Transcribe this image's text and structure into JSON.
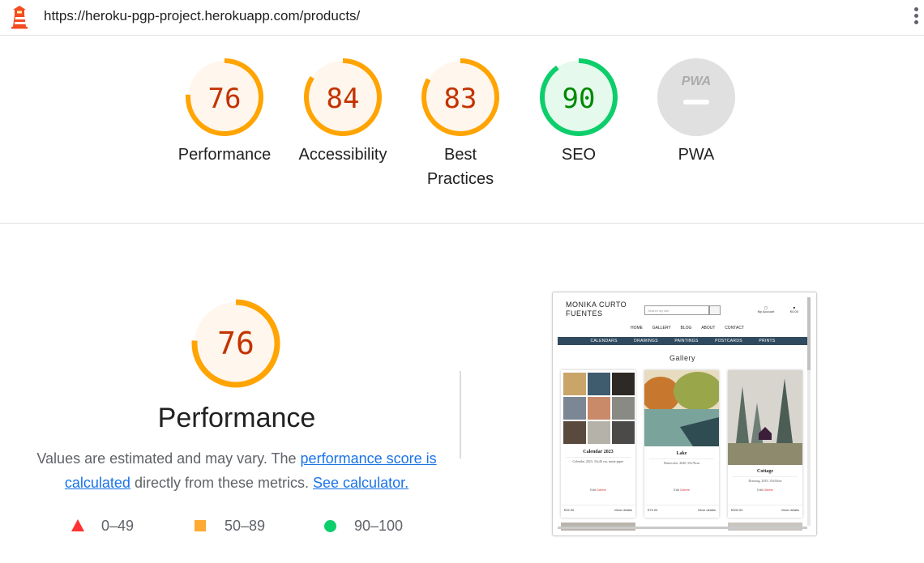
{
  "topbar": {
    "url": "https://heroku-pgp-project.herokuapp.com/products/",
    "logo_icon": "lighthouse-icon",
    "menu_icon": "kebab-menu-icon"
  },
  "gauges": [
    {
      "label": "Performance",
      "score": "76",
      "fraction": 0.76,
      "color": "#ffa400",
      "text_color": "#c33300",
      "bg": "#fff6ed"
    },
    {
      "label": "Accessibility",
      "score": "84",
      "fraction": 0.84,
      "color": "#ffa400",
      "text_color": "#c33300",
      "bg": "#fff6ed"
    },
    {
      "label": "Best Practices",
      "score": "83",
      "fraction": 0.83,
      "color": "#ffa400",
      "text_color": "#c33300",
      "bg": "#fff6ed"
    },
    {
      "label": "SEO",
      "score": "90",
      "fraction": 0.9,
      "color": "#0cce6b",
      "text_color": "#008800",
      "bg": "#e5f9ed"
    },
    {
      "label": "PWA",
      "badge": "PWA",
      "color": "#e0e0e0"
    }
  ],
  "performance": {
    "score": "76",
    "fraction": 0.76,
    "title": "Performance",
    "desc_prefix": "Values are estimated and may vary. The ",
    "score_link": "performance score is calculated",
    "desc_middle": " directly from these metrics. ",
    "calc_link": "See calculator.",
    "legend": [
      {
        "icon": "red-triangle-icon",
        "range": "0–49",
        "color": "#ff3333"
      },
      {
        "icon": "orange-square-icon",
        "range": "50–89",
        "color": "#ffaa33"
      },
      {
        "icon": "green-circle-icon",
        "range": "90–100",
        "color": "#0cce6b"
      }
    ]
  },
  "thumbnail": {
    "brand": "MONIKA CURTO FUENTES",
    "search_placeholder": "Search my site",
    "account": "My Account",
    "bag_total": "€0.00",
    "nav": [
      "HOME",
      "GALLERY",
      "BLOG",
      "ABOUT",
      "CONTACT"
    ],
    "categories": [
      "CALENDARS",
      "DRAWINGS",
      "PAINTINGS",
      "POSTCARDS",
      "PRINTS"
    ],
    "heading": "Gallery",
    "cards": [
      {
        "title": "Calendar 2023",
        "desc": "Calendar, 2023, 33x40 cm, matte paper",
        "edit": "Edit",
        "delete": "Delete",
        "price": "€32.00",
        "more": "More details"
      },
      {
        "title": "Lake",
        "desc": "Watercolor, 2020, 55x76cm",
        "edit": "Edit",
        "delete": "Delete",
        "price": "€79.00",
        "more": "More details"
      },
      {
        "title": "Cottage",
        "desc": "Drawing, 2019, 35x50cm",
        "edit": "Edit",
        "delete": "Delete",
        "price": "€300.00",
        "more": "More details"
      }
    ]
  }
}
